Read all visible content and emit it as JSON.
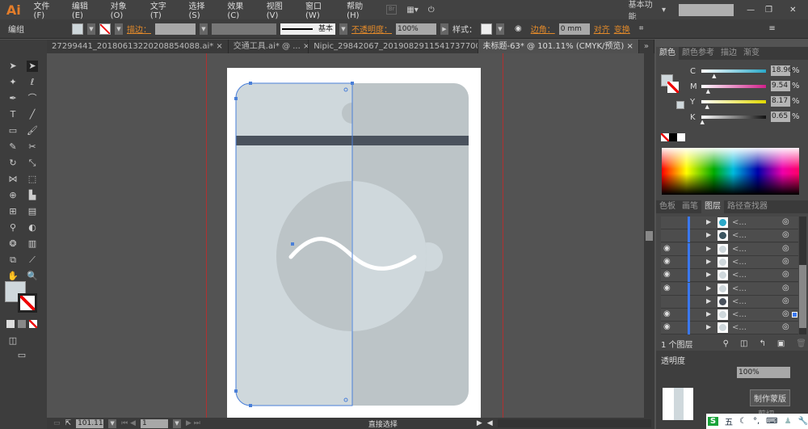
{
  "app": {
    "logo": "Ai"
  },
  "menu": [
    "文件(F)",
    "编辑(E)",
    "对象(O)",
    "文字(T)",
    "选择(S)",
    "效果(C)",
    "视图(V)",
    "窗口(W)",
    "帮助(H)"
  ],
  "workspace": "基本功能",
  "search": {
    "placeholder": ""
  },
  "control": {
    "selection": "编组",
    "stroke_label": "描边：",
    "stroke_profile": "基本",
    "opacity_label": "不透明度：",
    "opacity": "100%",
    "style_label": "样式：",
    "corner_label": "边角：",
    "corner_value": "0 mm",
    "align": "对齐",
    "transform": "变换"
  },
  "tabs": [
    {
      "label": "27299441_20180613220208854088.ai* ×"
    },
    {
      "label": "交通工具.ai* @ ... ×"
    },
    {
      "label": "Nipic_29842067_20190829115417377000.ai* ×"
    },
    {
      "label": "未标题-63* @ 101.11% (CMYK/预览)  ×",
      "active": true
    }
  ],
  "color_panel": {
    "tabs": [
      "颜色",
      "颜色参考",
      "描边",
      "渐变"
    ],
    "channels": [
      {
        "name": "C",
        "value": "18.96",
        "pct": 18.96,
        "color": "#2aa8c8"
      },
      {
        "name": "M",
        "value": "9.54",
        "pct": 9.54,
        "color": "#d0208a"
      },
      {
        "name": "Y",
        "value": "8.17",
        "pct": 8.17,
        "color": "#e0d800"
      },
      {
        "name": "K",
        "value": "0.65",
        "pct": 0.65,
        "color": "#111111"
      }
    ],
    "unit": "%",
    "fill_color": "#cfd8dc"
  },
  "layers_panel": {
    "tabs": [
      "色板",
      "画笔",
      "图层",
      "路径查找器"
    ],
    "rows": [
      {
        "visible": false,
        "name": "<..."
      },
      {
        "visible": false,
        "name": "<..."
      },
      {
        "visible": true,
        "name": "<..."
      },
      {
        "visible": true,
        "name": "<..."
      },
      {
        "visible": true,
        "name": "<..."
      },
      {
        "visible": true,
        "name": "<..."
      },
      {
        "visible": false,
        "name": "<..."
      },
      {
        "visible": true,
        "name": "<...",
        "selected": true
      },
      {
        "visible": true,
        "name": "<..."
      }
    ],
    "count": "1 个图层"
  },
  "transparency_panel": {
    "title": "透明度",
    "opacity": "100%",
    "make_mask": "制作蒙版",
    "clip": "剪切"
  },
  "status": {
    "zoom": "101.11",
    "page": "1",
    "tool": "直接选择"
  },
  "ime": [
    "五"
  ]
}
